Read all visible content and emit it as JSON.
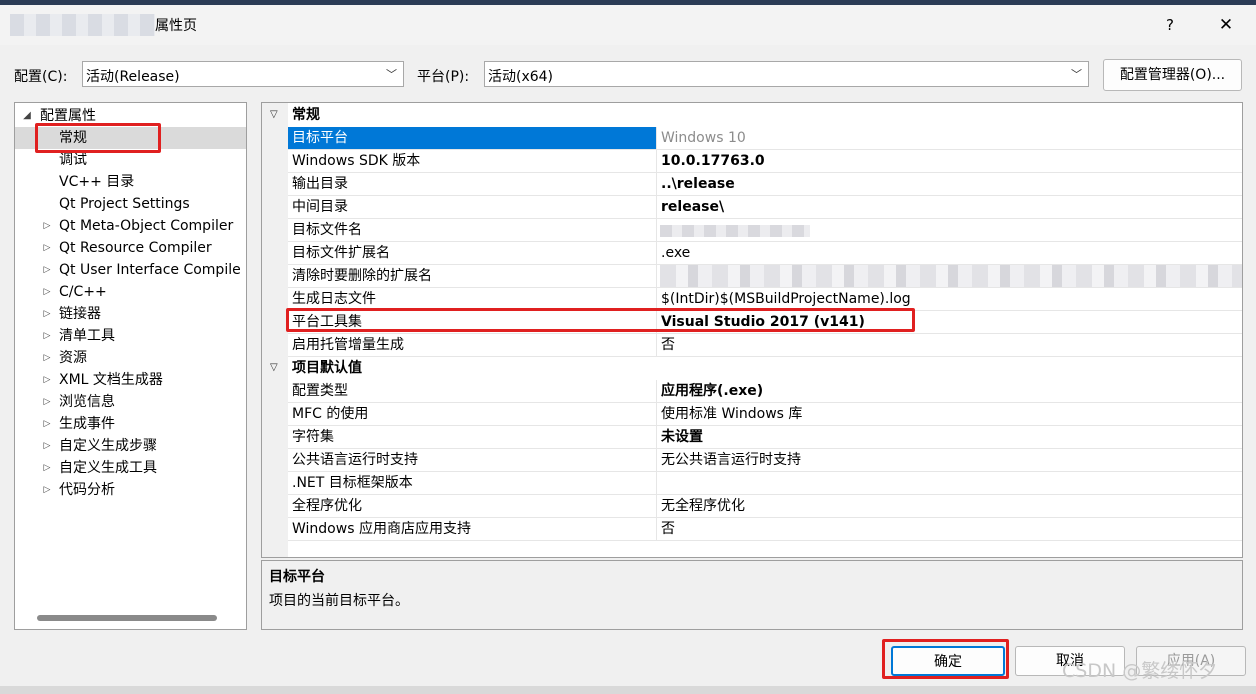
{
  "window": {
    "title": "属性页",
    "help_label": "?",
    "close_label": "✕"
  },
  "config": {
    "config_label": "配置(C):",
    "config_value": "活动(Release)",
    "platform_label": "平台(P):",
    "platform_value": "活动(x64)",
    "manager_button": "配置管理器(O)..."
  },
  "tree": {
    "root": "配置属性",
    "items": [
      {
        "label": "常规",
        "selected": true,
        "expandable": false
      },
      {
        "label": "调试",
        "expandable": false
      },
      {
        "label": "VC++ 目录",
        "expandable": false
      },
      {
        "label": "Qt Project Settings",
        "expandable": false
      },
      {
        "label": "Qt Meta-Object Compiler",
        "expandable": true
      },
      {
        "label": "Qt Resource Compiler",
        "expandable": true
      },
      {
        "label": "Qt User Interface Compile",
        "expandable": true
      },
      {
        "label": "C/C++",
        "expandable": true
      },
      {
        "label": "链接器",
        "expandable": true
      },
      {
        "label": "清单工具",
        "expandable": true
      },
      {
        "label": "资源",
        "expandable": true
      },
      {
        "label": "XML 文档生成器",
        "expandable": true
      },
      {
        "label": "浏览信息",
        "expandable": true
      },
      {
        "label": "生成事件",
        "expandable": true
      },
      {
        "label": "自定义生成步骤",
        "expandable": true
      },
      {
        "label": "自定义生成工具",
        "expandable": true
      },
      {
        "label": "代码分析",
        "expandable": true
      }
    ]
  },
  "grid": {
    "sections": [
      {
        "title": "常规",
        "rows": [
          {
            "name": "目标平台",
            "value": "Windows 10",
            "style": "gray",
            "selected": true
          },
          {
            "name": "Windows SDK 版本",
            "value": "10.0.17763.0",
            "style": "bold"
          },
          {
            "name": "输出目录",
            "value": "..\\release",
            "style": "bold"
          },
          {
            "name": "中间目录",
            "value": "release\\",
            "style": "bold"
          },
          {
            "name": "目标文件名",
            "value": "",
            "style": "blur-short"
          },
          {
            "name": "目标文件扩展名",
            "value": ".exe",
            "style": "normal"
          },
          {
            "name": "清除时要删除的扩展名",
            "value": "",
            "style": "blur-long"
          },
          {
            "name": "生成日志文件",
            "value": "$(IntDir)$(MSBuildProjectName).log",
            "style": "normal"
          },
          {
            "name": "平台工具集",
            "value": "Visual Studio 2017 (v141)",
            "style": "bold"
          },
          {
            "name": "启用托管增量生成",
            "value": "否",
            "style": "normal"
          }
        ]
      },
      {
        "title": "项目默认值",
        "rows": [
          {
            "name": "配置类型",
            "value": "应用程序(.exe)",
            "style": "bold"
          },
          {
            "name": "MFC 的使用",
            "value": "使用标准 Windows 库",
            "style": "normal"
          },
          {
            "name": "字符集",
            "value": "未设置",
            "style": "bold"
          },
          {
            "name": "公共语言运行时支持",
            "value": "无公共语言运行时支持",
            "style": "normal"
          },
          {
            "name": ".NET 目标框架版本",
            "value": "",
            "style": "normal"
          },
          {
            "name": "全程序优化",
            "value": "无全程序优化",
            "style": "normal"
          },
          {
            "name": "Windows 应用商店应用支持",
            "value": "否",
            "style": "normal"
          }
        ]
      }
    ]
  },
  "description": {
    "title": "目标平台",
    "text": "项目的当前目标平台。"
  },
  "buttons": {
    "ok": "确定",
    "cancel": "取消",
    "apply": "应用(A)"
  },
  "watermark": "CSDN @繁缕怀夕",
  "colors": {
    "selection": "#0078d7",
    "highlight_box": "#e02020",
    "dialog_bg": "#f0f0f0"
  }
}
